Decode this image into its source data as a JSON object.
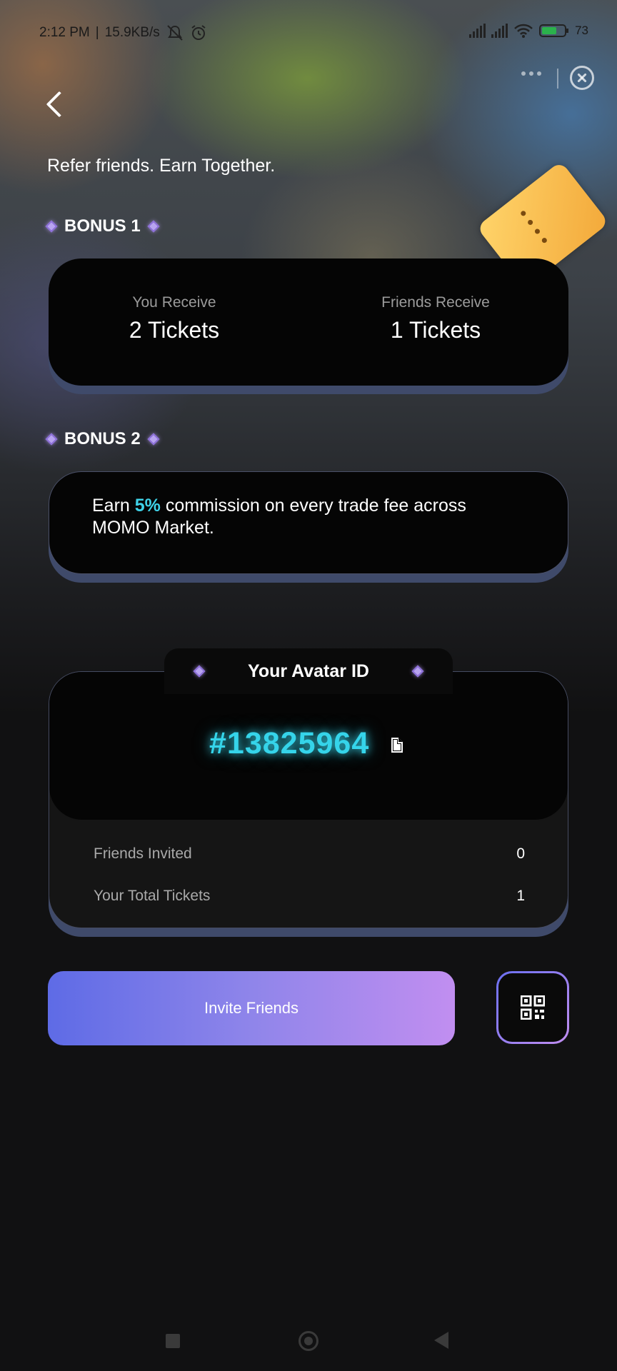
{
  "status_bar": {
    "time": "2:12 PM",
    "net_speed": "15.9KB/s",
    "battery": "73"
  },
  "icons": {
    "back": "chevron-left-icon",
    "more": "more-dots-icon",
    "close": "close-circle-icon",
    "copy": "copy-icon",
    "qr": "qr-code-icon",
    "decor": "ticket-icon"
  },
  "page": {
    "headline": "Refer friends. Earn Together."
  },
  "bonus1": {
    "label": "BONUS 1",
    "you_receive_label": "You Receive",
    "you_receive_value": "2 Tickets",
    "friends_receive_label": "Friends Receive",
    "friends_receive_value": "1 Tickets"
  },
  "bonus2": {
    "label": "BONUS 2",
    "text_before": "Earn ",
    "percent": "5%",
    "text_after": " commission on every trade fee across MOMO Market."
  },
  "avatar": {
    "title": "Your Avatar ID",
    "id": "#13825964",
    "stats": [
      {
        "label": "Friends Invited",
        "value": "0"
      },
      {
        "label": "Your Total Tickets",
        "value": "1"
      }
    ]
  },
  "actions": {
    "invite_label": "Invite Friends"
  },
  "colors": {
    "accent_cyan": "#35d4ea",
    "gradient_start": "#5e6be6",
    "gradient_end": "#c18ef0"
  }
}
